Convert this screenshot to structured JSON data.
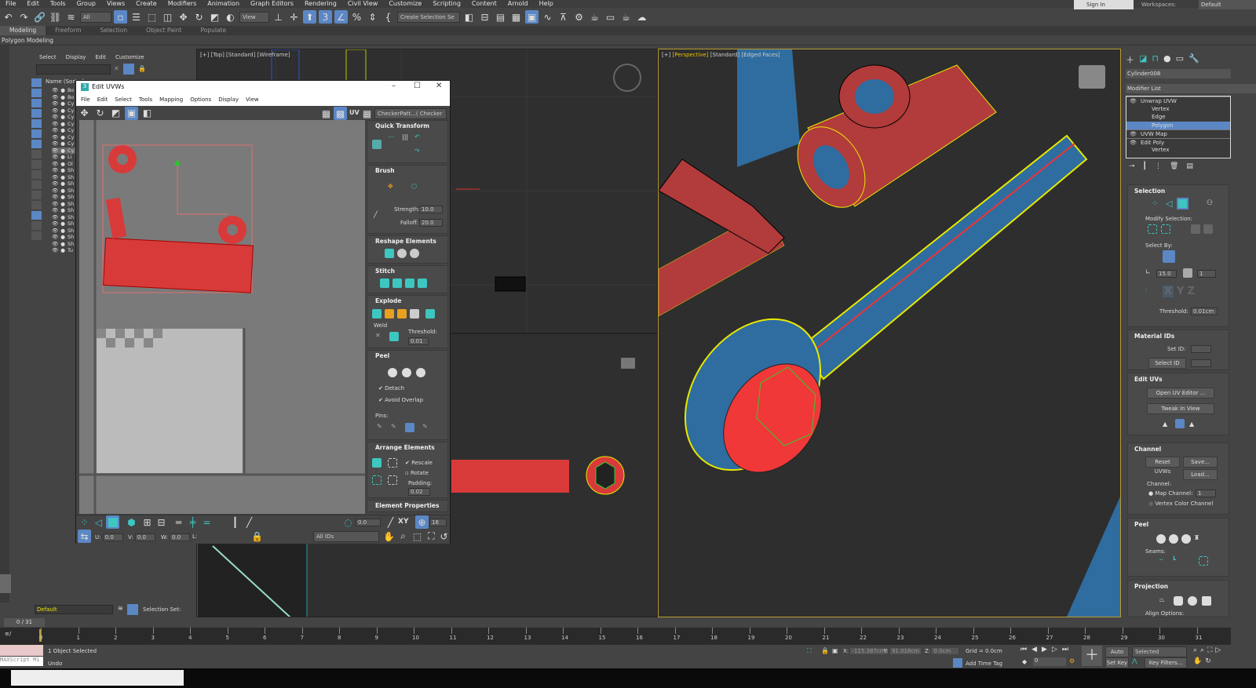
{
  "menu": [
    "File",
    "Edit",
    "Tools",
    "Group",
    "Views",
    "Create",
    "Modifiers",
    "Animation",
    "Graph Editors",
    "Rendering",
    "Civil View",
    "Customize",
    "Scripting",
    "Content",
    "Arnold",
    "Help"
  ],
  "toolbar": {
    "filter": "All",
    "refcoord": "View",
    "selection_set": "Create Selection Se"
  },
  "account": {
    "sign_in": "Sign In",
    "workspaces_label": "Workspaces:",
    "workspace": "Default"
  },
  "ribbon": {
    "tabs": [
      "Modeling",
      "Freeform",
      "Selection",
      "Object Paint",
      "Populate"
    ],
    "sub": "Polygon Modeling"
  },
  "explorer": {
    "menu": [
      "Select",
      "Display",
      "Edit",
      "Customize"
    ],
    "column": "Name (Sorted",
    "rows": [
      "Bo",
      "Bo",
      "Cy",
      "Cy",
      "Cy",
      "Cy",
      "Cy",
      "Cy",
      "Cy",
      "Cy",
      "Li",
      "Ol",
      "Sh",
      "Sh",
      "Sh",
      "Sh",
      "Sh",
      "Sh",
      "Sh",
      "Sh",
      "Sh",
      "Sh",
      "Sh",
      "Sh",
      "Tu"
    ]
  },
  "viewports": {
    "top": "[+] [Top] [Standard] [Wireframe]",
    "persp_plus": "[+]",
    "persp_view": "[Perspective]",
    "persp_rest": "[Standard] [Edged Faces]"
  },
  "uvw": {
    "title": "Edit UVWs",
    "menu": [
      "File",
      "Edit",
      "Select",
      "Tools",
      "Mapping",
      "Options",
      "Display",
      "View"
    ],
    "uv_label": "UV",
    "texture": "CheckerPatt...( Checker )",
    "quick_transform": "Quick Transform",
    "brush": "Brush",
    "strength_label": "Strength:",
    "strength": "10.0",
    "falloff_label": "Falloff:",
    "falloff": "20.0",
    "reshape": "Reshape Elements",
    "stitch": "Stitch",
    "explode": "Explode",
    "weld": "Weld",
    "threshold_label": "Threshold:",
    "threshold": "0.01",
    "peel": "Peel",
    "detach": "Detach",
    "avoid_overlap": "Avoid Overlap",
    "pins": "Pins:",
    "arrange": "Arrange Elements",
    "rescale": "Rescale",
    "rotate": "Rotate",
    "padding_label": "Padding:",
    "padding": "0.02",
    "element_props": "Element Properties",
    "rotate_val": "0.0",
    "xy": "XY",
    "grid_val": "16",
    "u_label": "U:",
    "u": "0.0",
    "v_label": "V:",
    "v": "0.0",
    "w_label": "W:",
    "w": "0.0",
    "l_label": "L:",
    "ids": "All IDs"
  },
  "cmd": {
    "object_name": "Cylinder008",
    "modifier_list": "Modifier List",
    "stack": [
      {
        "label": "Unwrap UVW",
        "level": 0
      },
      {
        "label": "Vertex",
        "level": 1
      },
      {
        "label": "Edge",
        "level": 1
      },
      {
        "label": "Polygon",
        "level": 1,
        "selected": true
      },
      {
        "label": "UVW Map",
        "level": 0
      },
      {
        "label": "Edit Poly",
        "level": 0
      },
      {
        "label": "Vertex",
        "level": 1
      }
    ],
    "selection": "Selection",
    "modify_selection": "Modify Selection:",
    "select_by": "Select By:",
    "angle": "15.0",
    "loop": "1",
    "axes": [
      "X",
      "Y",
      "Z"
    ],
    "threshold_label": "Threshold:",
    "threshold": "0.01cm",
    "material_ids": "Material IDs",
    "set_id": "Set ID:",
    "select_id": "Select ID",
    "edit_uvs": "Edit UVs",
    "open_uv_editor": "Open UV Editor ...",
    "tweak_in_view": "Tweak In View",
    "channel": "Channel",
    "reset_uvws": "Reset UVWs",
    "save": "Save...",
    "load": "Load...",
    "channel_label": "Channel:",
    "map_channel": "Map Channel:",
    "map_channel_val": "1",
    "vertex_color_channel": "Vertex Color Channel",
    "peel": "Peel",
    "seams": "Seams:",
    "projection": "Projection",
    "align_options": "Align Options:"
  },
  "bottom": {
    "layer": "Default",
    "selection_set": "Selection Set:",
    "frame": "0 / 31",
    "ticks": [
      0,
      1,
      2,
      3,
      4,
      5,
      6,
      7,
      8,
      9,
      10,
      11,
      12,
      13,
      14,
      15,
      16,
      17,
      18,
      19,
      20,
      21,
      22,
      23,
      24,
      25,
      26,
      27,
      28,
      29,
      30,
      31
    ],
    "status1": "1 Object Selected",
    "status2": "Undo",
    "maxscript": "MAXScript Mi",
    "x_label": "X:",
    "x": "-115.387cm",
    "y_label": "Y:",
    "y": "91.018cm",
    "z_label": "Z:",
    "z": "0.0cm",
    "grid": "Grid = 0.0cm",
    "add_time_tag": "Add Time Tag",
    "current_frame": "0",
    "auto_key": "Auto Key",
    "set_key": "Set Key",
    "key_mode": "Selected",
    "key_filters": "Key Filters..."
  },
  "colors": {
    "accent": "#5b87c5",
    "teal": "#3ec6c0",
    "selection_yellow": "#e8e800",
    "uv_red": "#d83a3a",
    "mesh_blue": "#2f6da0"
  }
}
